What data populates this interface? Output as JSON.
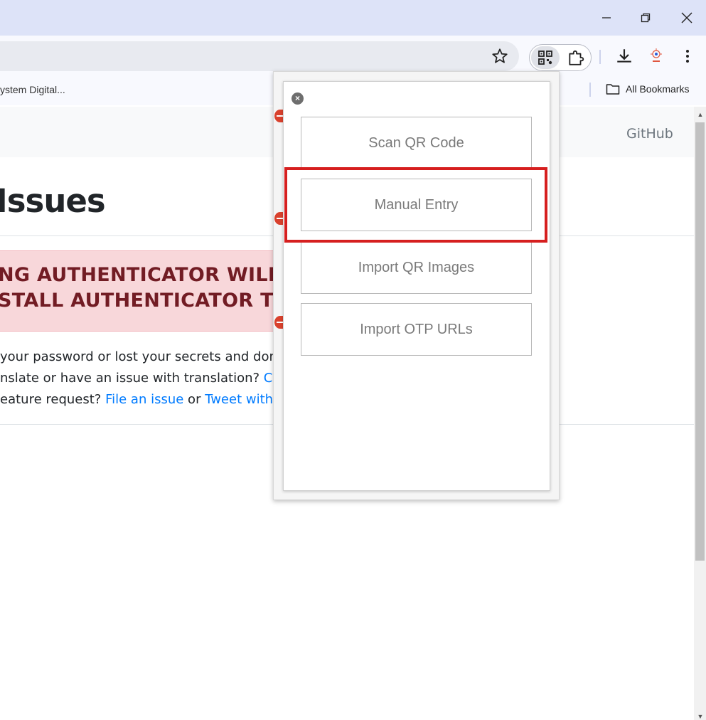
{
  "browser": {
    "bookmarks_left": "ystem Digital...",
    "bookmarks_right": "All Bookmarks"
  },
  "page": {
    "nav_link": "GitHub",
    "heading": "Issues",
    "alert_line1": "NG AUTHENTICATOR WILL CI",
    "alert_line2": "STALL AUTHENTICATOR TO I",
    "para1": " your password or lost your secrets and don",
    "para2_text": "nslate or have an issue with translation? ",
    "para2_link": "Che",
    "para3_text": "eature request? ",
    "para3_link1": "File an issue",
    "para3_or": " or ",
    "para3_link2": "Tweet with @"
  },
  "popup": {
    "close_symbol": "×",
    "buttons": [
      "Scan QR Code",
      "Manual Entry",
      "Import QR Images",
      "Import OTP URLs"
    ],
    "highlighted": "Manual Entry"
  },
  "colors": {
    "highlight": "#d61f1f",
    "alert_text": "#721c24",
    "link": "#007bff"
  }
}
